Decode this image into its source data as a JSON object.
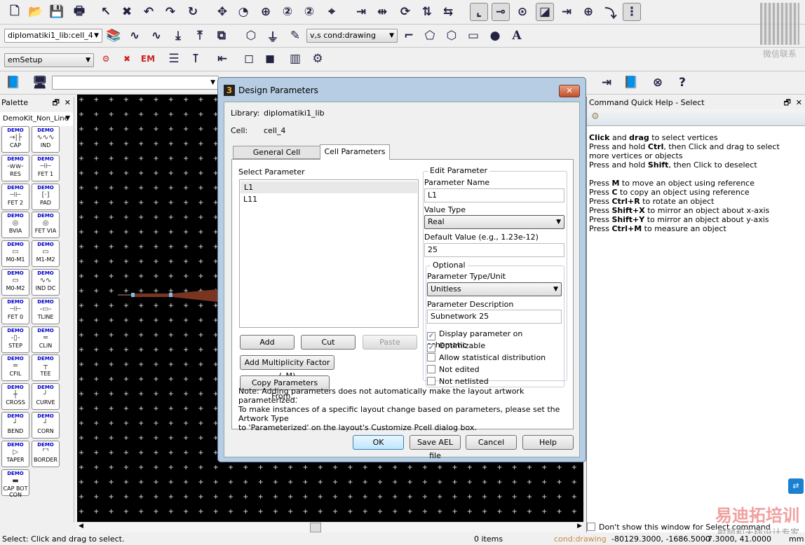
{
  "toolbar": {
    "row1": [
      "new-file-icon",
      "open-folder-icon",
      "save-icon",
      "print-icon",
      "pointer-icon",
      "delete-icon",
      "undo-icon",
      "redo-icon",
      "repeat-icon",
      "pan-icon",
      "zoom-area-icon",
      "zoom-in-icon",
      "zoom-in-2x-icon",
      "zoom-out-2x-icon",
      "center-icon",
      "align-left-icon",
      "align-spaced-icon",
      "rotate-icon",
      "mirror-x-icon",
      "mirror-y-icon",
      "snap-grid-icon",
      "snap-pin-icon",
      "snap-vertex-icon",
      "snap-edge-icon",
      "snap-midpoint-icon",
      "snap-center-icon",
      "snap-intersection-icon",
      "snap-array-icon"
    ],
    "row2_combo": "diplomatiki1_lib:cell_4",
    "row2": [
      "library-icon",
      "tune-icon",
      "optimize-icon",
      "import-icon",
      "export-icon",
      "layer-stack-icon",
      "port-icon",
      "ground-icon",
      "pencil-icon"
    ],
    "layer_combo": "v,s cond:drawing",
    "row2b": [
      "trace-icon",
      "polygon-icon",
      "polyline-icon",
      "rectangle-icon",
      "circle-icon",
      "text-icon"
    ],
    "row3_combo": "emSetup",
    "row3": [
      "em-simulate-icon",
      "em-stop-icon",
      "em-view-icon",
      "substrate-icon",
      "port-edit-icon",
      "component-icon",
      "3d-wireframe-icon",
      "3d-solid-icon",
      "3d-layers-icon",
      "fem-setup-icon"
    ],
    "row4": [
      "help-book-icon",
      "pcb-icon"
    ],
    "row4_input": "",
    "row4r": [
      "datasheet-icon",
      "library-book-icon",
      "globe-icon",
      "help-question-icon"
    ]
  },
  "watermark": {
    "qr_caption": "微信联系",
    "brand": "易迪拓培训",
    "brand_sub": "射频和天线设计专家"
  },
  "palette": {
    "title": "Palette",
    "library": "DemoKit_Non_Line",
    "demo": "DEMO",
    "items": [
      {
        "label": "CAP",
        "sym": "→|├"
      },
      {
        "label": "IND",
        "sym": "∿∿∿"
      },
      {
        "label": "RES",
        "sym": "-ww-"
      },
      {
        "label": "FET 1",
        "sym": "⊣⊢"
      },
      {
        "label": "FET 2",
        "sym": "⊣⊢"
      },
      {
        "label": "PAD",
        "sym": "[·]"
      },
      {
        "label": "BVIA",
        "sym": "◎"
      },
      {
        "label": "FET VIA",
        "sym": "◎"
      },
      {
        "label": "M0-M1",
        "sym": "▭"
      },
      {
        "label": "M1-M2",
        "sym": "▭"
      },
      {
        "label": "M0-M2",
        "sym": "▭"
      },
      {
        "label": "IND DC",
        "sym": "∿∿"
      },
      {
        "label": "FET 0",
        "sym": "⊣⊢"
      },
      {
        "label": "TLINE",
        "sym": "-▭-"
      },
      {
        "label": "STEP",
        "sym": "-▯-"
      },
      {
        "label": "CLIN",
        "sym": "═"
      },
      {
        "label": "CFIL",
        "sym": "═"
      },
      {
        "label": "TEE",
        "sym": "┬"
      },
      {
        "label": "CROSS",
        "sym": "┼"
      },
      {
        "label": "CURVE",
        "sym": "╯"
      },
      {
        "label": "BEND",
        "sym": "┘"
      },
      {
        "label": "CORN",
        "sym": "┘"
      },
      {
        "label": "TAPER",
        "sym": "▷"
      },
      {
        "label": "BORDER",
        "sym": "⌜⌝"
      },
      {
        "label": "CAP BOT CON",
        "sym": "▬"
      }
    ]
  },
  "dialog": {
    "title": "Design Parameters",
    "library_label": "Library:",
    "library": "diplomatiki1_lib",
    "cell_label": "Cell:",
    "cell": "cell_4",
    "tabs": [
      "General Cell Definition",
      "Cell Parameters"
    ],
    "select_label": "Select Parameter",
    "params": [
      "L1",
      "L11"
    ],
    "add": "Add",
    "cut": "Cut",
    "paste": "Paste",
    "add_mult": "Add Multiplicity Factor (_M)",
    "copy_from": "Copy Parameters From...",
    "edit_label": "Edit Parameter",
    "name_label": "Parameter Name",
    "name": "L1",
    "vtype_label": "Value Type",
    "vtype": "Real",
    "default_label": "Default Value (e.g., 1.23e-12)",
    "default": "25",
    "optional": "Optional",
    "unit_label": "Parameter Type/Unit",
    "unit": "Unitless",
    "desc_label": "Parameter Description",
    "desc": "Subnetwork 25",
    "checks": [
      {
        "label": "Display parameter on schematic",
        "checked": true
      },
      {
        "label": "Optimizable",
        "checked": true
      },
      {
        "label": "Allow statistical distribution",
        "checked": false
      },
      {
        "label": "Not edited",
        "checked": false
      },
      {
        "label": "Not netlisted",
        "checked": false
      }
    ],
    "note": [
      "Note: Adding parameters does not automatically make the layout artwork parameterized.",
      "To make instances of a specific layout change based on parameters, please set the Artwork Type",
      "to 'Parameterized' on the layout's Customize Pcell dialog box."
    ],
    "ok": "OK",
    "save_ael": "Save AEL file",
    "cancel": "Cancel",
    "help": "Help"
  },
  "quickhelp": {
    "title": "Command Quick Help - Select",
    "lines": [
      [
        "Click",
        " and ",
        "drag",
        " to select vertices"
      ],
      [
        "Press and hold ",
        "Ctrl",
        ", then Click and drag to select more vertices or objects"
      ],
      [
        "Press and hold ",
        "Shift",
        ", then Click to deselect"
      ],
      [
        ""
      ],
      [
        "Press ",
        "M",
        " to move an object using reference"
      ],
      [
        "Press ",
        "C",
        " to copy an object using reference"
      ],
      [
        "Press ",
        "Ctrl+R",
        " to rotate an object"
      ],
      [
        "Press ",
        "Shift+X",
        " to mirror an object about x-axis"
      ],
      [
        "Press ",
        "Shift+Y",
        " to mirror an object about y-axis"
      ],
      [
        "Press ",
        "Ctrl+M",
        " to measure an object"
      ]
    ],
    "dont_show": "Don't show this window for Select command"
  },
  "status": {
    "message": "Select: Click and drag to select.",
    "items": "0 items",
    "layer": "cond:drawing",
    "coords": "-80129.3000, -1686.5000",
    "delta": "-7.3000, 41.0000",
    "unit": "mm"
  }
}
